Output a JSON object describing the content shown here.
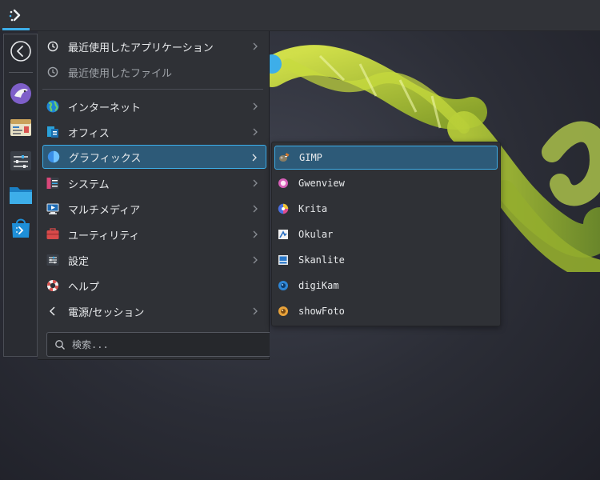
{
  "taskbar": {
    "launcher_icon": "kde-launcher-icon",
    "accent": "#3daee9"
  },
  "sidebar": {
    "favorites": [
      {
        "name": "back-icon"
      },
      {
        "name": "falkon-browser-icon"
      },
      {
        "name": "settings-app-icon"
      },
      {
        "name": "system-settings-icon"
      },
      {
        "name": "file-manager-icon"
      },
      {
        "name": "discover-store-icon"
      }
    ]
  },
  "menu": {
    "items": [
      {
        "label": "最近使用したアプリケーション",
        "icon": "clock-icon",
        "has_submenu": true
      },
      {
        "label": "最近使用したファイル",
        "icon": "clock-icon",
        "has_submenu": false
      },
      {
        "label": "インターネット",
        "icon": "globe-icon",
        "has_submenu": true
      },
      {
        "label": "オフィス",
        "icon": "office-icon",
        "has_submenu": true
      },
      {
        "label": "グラフィックス",
        "icon": "graphics-icon",
        "has_submenu": true
      },
      {
        "label": "システム",
        "icon": "system-icon",
        "has_submenu": true
      },
      {
        "label": "マルチメディア",
        "icon": "multimedia-icon",
        "has_submenu": true
      },
      {
        "label": "ユーティリティ",
        "icon": "utilities-icon",
        "has_submenu": true
      },
      {
        "label": "設定",
        "icon": "settings-icon",
        "has_submenu": true
      },
      {
        "label": "ヘルプ",
        "icon": "help-icon",
        "has_submenu": false
      },
      {
        "label": "電源/セッション",
        "icon": "chevron-left-icon",
        "has_submenu": true
      }
    ],
    "active": "グラフィックス"
  },
  "search": {
    "placeholder": "検索...",
    "value": ""
  },
  "submenu": {
    "items": [
      {
        "label": "GIMP",
        "icon": "gimp-icon"
      },
      {
        "label": "Gwenview",
        "icon": "gwenview-icon"
      },
      {
        "label": "Krita",
        "icon": "krita-icon"
      },
      {
        "label": "Okular",
        "icon": "okular-icon"
      },
      {
        "label": "Skanlite",
        "icon": "skanlite-icon"
      },
      {
        "label": "digiKam",
        "icon": "digikam-icon"
      },
      {
        "label": "showFoto",
        "icon": "showfoto-icon"
      }
    ],
    "active": "GIMP"
  }
}
